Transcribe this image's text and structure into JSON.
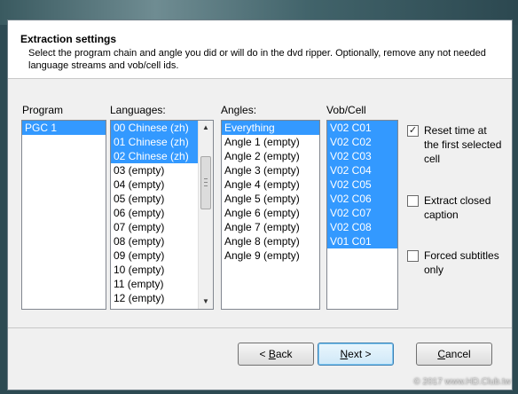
{
  "header": {
    "title": "Extraction settings",
    "description": "Select the program chain and angle you did or will do in the dvd ripper. Optionally, remove any not needed language streams and vob/cell ids."
  },
  "columns": {
    "program": {
      "label": "Program",
      "items": [
        {
          "text": "PGC 1",
          "selected": true
        }
      ]
    },
    "languages": {
      "label": "Languages:",
      "items": [
        {
          "text": "00 Chinese (zh)",
          "selected": true
        },
        {
          "text": "01 Chinese (zh)",
          "selected": true
        },
        {
          "text": "02 Chinese (zh)",
          "selected": true
        },
        {
          "text": "03 (empty)",
          "selected": false
        },
        {
          "text": "04 (empty)",
          "selected": false
        },
        {
          "text": "05 (empty)",
          "selected": false
        },
        {
          "text": "06 (empty)",
          "selected": false
        },
        {
          "text": "07 (empty)",
          "selected": false
        },
        {
          "text": "08 (empty)",
          "selected": false
        },
        {
          "text": "09 (empty)",
          "selected": false
        },
        {
          "text": "10 (empty)",
          "selected": false
        },
        {
          "text": "11 (empty)",
          "selected": false
        },
        {
          "text": "12 (empty)",
          "selected": false
        }
      ]
    },
    "angles": {
      "label": "Angles:",
      "items": [
        {
          "text": "Everything",
          "selected": true
        },
        {
          "text": "Angle 1 (empty)",
          "selected": false
        },
        {
          "text": "Angle 2 (empty)",
          "selected": false
        },
        {
          "text": "Angle 3 (empty)",
          "selected": false
        },
        {
          "text": "Angle 4 (empty)",
          "selected": false
        },
        {
          "text": "Angle 5 (empty)",
          "selected": false
        },
        {
          "text": "Angle 6 (empty)",
          "selected": false
        },
        {
          "text": "Angle 7 (empty)",
          "selected": false
        },
        {
          "text": "Angle 8 (empty)",
          "selected": false
        },
        {
          "text": "Angle 9 (empty)",
          "selected": false
        }
      ]
    },
    "vobcell": {
      "label": "Vob/Cell",
      "items": [
        {
          "text": "V02 C01",
          "selected": true
        },
        {
          "text": "V02 C02",
          "selected": true
        },
        {
          "text": "V02 C03",
          "selected": true
        },
        {
          "text": "V02 C04",
          "selected": true
        },
        {
          "text": "V02 C05",
          "selected": true
        },
        {
          "text": "V02 C06",
          "selected": true
        },
        {
          "text": "V02 C07",
          "selected": true
        },
        {
          "text": "V02 C08",
          "selected": true
        },
        {
          "text": "V01 C01",
          "selected": true
        }
      ]
    }
  },
  "options": {
    "reset_time": {
      "label": "Reset time at the first selected cell",
      "checked": true
    },
    "closed_caption": {
      "label": "Extract closed caption",
      "checked": false
    },
    "forced_subs": {
      "label": "Forced subtitles only",
      "checked": false
    }
  },
  "buttons": {
    "back": {
      "prefix": "< ",
      "mnemonic": "B",
      "rest": "ack"
    },
    "next": {
      "mnemonic": "N",
      "rest": "ext >"
    },
    "cancel": {
      "mnemonic": "C",
      "rest": "ancel"
    }
  },
  "watermark": "© 2017 www.HD.Club.tw"
}
